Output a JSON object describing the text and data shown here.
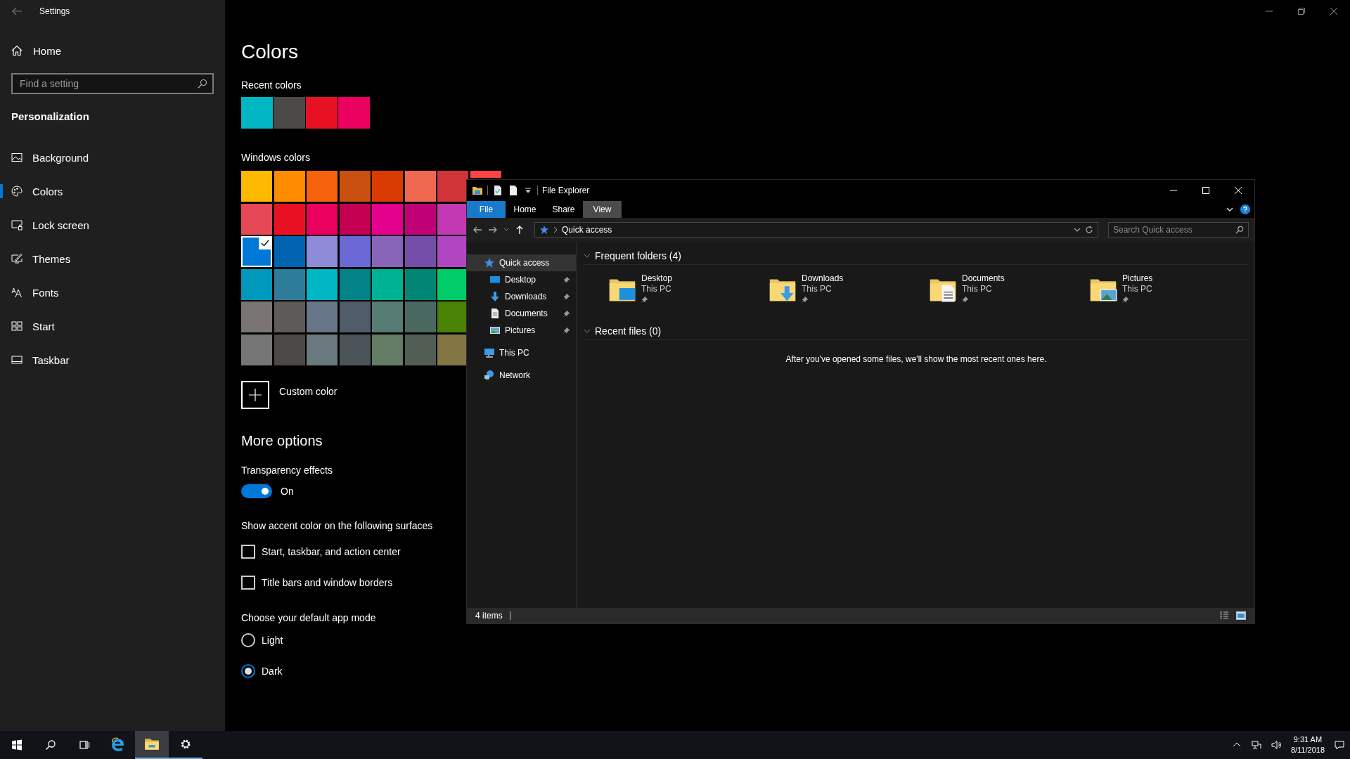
{
  "settings": {
    "title": "Settings",
    "home": "Home",
    "search": {
      "placeholder": "Find a setting"
    },
    "section": "Personalization",
    "nav": [
      {
        "label": "Background",
        "kind": "background",
        "selected": false
      },
      {
        "label": "Colors",
        "kind": "colors",
        "selected": true
      },
      {
        "label": "Lock screen",
        "kind": "lock",
        "selected": false
      },
      {
        "label": "Themes",
        "kind": "themes",
        "selected": false
      },
      {
        "label": "Fonts",
        "kind": "fonts",
        "selected": false
      },
      {
        "label": "Start",
        "kind": "start",
        "selected": false
      },
      {
        "label": "Taskbar",
        "kind": "taskbar",
        "selected": false
      }
    ],
    "page_title": "Colors",
    "recent_colors": {
      "label": "Recent colors",
      "swatches": [
        {
          "color": "#00b7c3"
        },
        {
          "color": "#4c4a48"
        },
        {
          "color": "#e81123"
        },
        {
          "color": "#ea005e"
        }
      ]
    },
    "windows_colors": {
      "label": "Windows colors",
      "rows": [
        {
          "swatches": [
            {
              "color": "#ffb900",
              "selected": false
            },
            {
              "color": "#ff8c00",
              "selected": false
            },
            {
              "color": "#f7630c",
              "selected": false
            },
            {
              "color": "#ca5010",
              "selected": false
            },
            {
              "color": "#da3b01",
              "selected": false
            },
            {
              "color": "#ef6950",
              "selected": false
            },
            {
              "color": "#d13438",
              "selected": false
            },
            {
              "color": "#ff4343",
              "selected": false
            }
          ]
        },
        {
          "swatches": [
            {
              "color": "#e74856",
              "selected": false
            },
            {
              "color": "#e81123",
              "selected": false
            },
            {
              "color": "#ea005e",
              "selected": false
            },
            {
              "color": "#c30052",
              "selected": false
            },
            {
              "color": "#e3008c",
              "selected": false
            },
            {
              "color": "#bf0077",
              "selected": false
            },
            {
              "color": "#c239b3",
              "selected": false
            }
          ]
        },
        {
          "swatches": [
            {
              "color": "#0078d7",
              "selected": true
            },
            {
              "color": "#0063b1",
              "selected": false
            },
            {
              "color": "#8e8cd8",
              "selected": false
            },
            {
              "color": "#6b69d6",
              "selected": false
            },
            {
              "color": "#8764b8",
              "selected": false
            },
            {
              "color": "#744da9",
              "selected": false
            },
            {
              "color": "#b146c2",
              "selected": false
            }
          ]
        },
        {
          "swatches": [
            {
              "color": "#0099bc",
              "selected": false
            },
            {
              "color": "#2d7d9a",
              "selected": false
            },
            {
              "color": "#00b7c3",
              "selected": false
            },
            {
              "color": "#038387",
              "selected": false
            },
            {
              "color": "#00b294",
              "selected": false
            },
            {
              "color": "#018574",
              "selected": false
            },
            {
              "color": "#00cc6a",
              "selected": false
            }
          ]
        },
        {
          "swatches": [
            {
              "color": "#7a7574",
              "selected": false
            },
            {
              "color": "#5d5a58",
              "selected": false
            },
            {
              "color": "#68768a",
              "selected": false
            },
            {
              "color": "#515c6b",
              "selected": false
            },
            {
              "color": "#567c73",
              "selected": false
            },
            {
              "color": "#486860",
              "selected": false
            },
            {
              "color": "#498205",
              "selected": false
            }
          ]
        },
        {
          "swatches": [
            {
              "color": "#767676",
              "selected": false
            },
            {
              "color": "#4c4a48",
              "selected": false
            },
            {
              "color": "#69797e",
              "selected": false
            },
            {
              "color": "#4a5459",
              "selected": false
            },
            {
              "color": "#647c64",
              "selected": false
            },
            {
              "color": "#525e54",
              "selected": false
            },
            {
              "color": "#847545",
              "selected": false
            }
          ]
        }
      ]
    },
    "custom_color": "Custom color",
    "more_options": {
      "title": "More options",
      "transparency": {
        "label": "Transparency effects",
        "on": true,
        "state": "On"
      },
      "accent": {
        "label": "Show accent color on the following surfaces",
        "options": [
          {
            "label": "Start, taskbar, and action center",
            "checked": false
          },
          {
            "label": "Title bars and window borders",
            "checked": false
          }
        ]
      },
      "app_mode": {
        "label": "Choose your default app mode",
        "options": [
          {
            "label": "Light",
            "selected": false
          },
          {
            "label": "Dark",
            "selected": true
          }
        ]
      }
    }
  },
  "explorer": {
    "title": "File Explorer",
    "tabs": [
      {
        "label": "File",
        "kind": "file",
        "selected": false
      },
      {
        "label": "Home",
        "kind": "tab",
        "selected": false
      },
      {
        "label": "Share",
        "kind": "tab",
        "selected": false
      },
      {
        "label": "View",
        "kind": "tab",
        "selected": true
      }
    ],
    "address": "Quick access",
    "search": {
      "placeholder": "Search Quick access"
    },
    "tree": [
      {
        "label": "Quick access",
        "kind": "quick",
        "selected": true,
        "children": [
          {
            "label": "Desktop",
            "kind": "desktop",
            "pinned": true
          },
          {
            "label": "Downloads",
            "kind": "downloads",
            "pinned": true
          },
          {
            "label": "Documents",
            "kind": "documents",
            "pinned": true
          },
          {
            "label": "Pictures",
            "kind": "pictures",
            "pinned": true
          }
        ]
      },
      {
        "label": "This PC",
        "kind": "pc",
        "selected": false
      },
      {
        "label": "Network",
        "kind": "network",
        "selected": false
      }
    ],
    "sections": [
      {
        "title": "Frequent folders (4)",
        "expanded": true,
        "folders": [
          {
            "name": "Desktop",
            "location": "This PC",
            "kind": "desktop",
            "pinned": true
          },
          {
            "name": "Downloads",
            "location": "This PC",
            "kind": "downloads",
            "pinned": true
          },
          {
            "name": "Documents",
            "location": "This PC",
            "kind": "documents",
            "pinned": true
          },
          {
            "name": "Pictures",
            "location": "This PC",
            "kind": "pictures",
            "pinned": true
          }
        ]
      },
      {
        "title": "Recent files (0)",
        "expanded": true,
        "empty_message": "After you've opened some files, we'll show the most recent ones here."
      }
    ],
    "status": "4 items"
  },
  "taskbar": {
    "apps": [
      {
        "kind": "start",
        "running": false,
        "focused": false
      },
      {
        "kind": "search",
        "running": false,
        "focused": false
      },
      {
        "kind": "taskview",
        "running": false,
        "focused": false
      },
      {
        "kind": "browser",
        "running": false,
        "focused": false
      },
      {
        "kind": "explorer",
        "running": true,
        "focused": true
      },
      {
        "kind": "settings",
        "running": true,
        "focused": false
      }
    ],
    "time": "9:31 AM",
    "date": "8/11/2018"
  }
}
